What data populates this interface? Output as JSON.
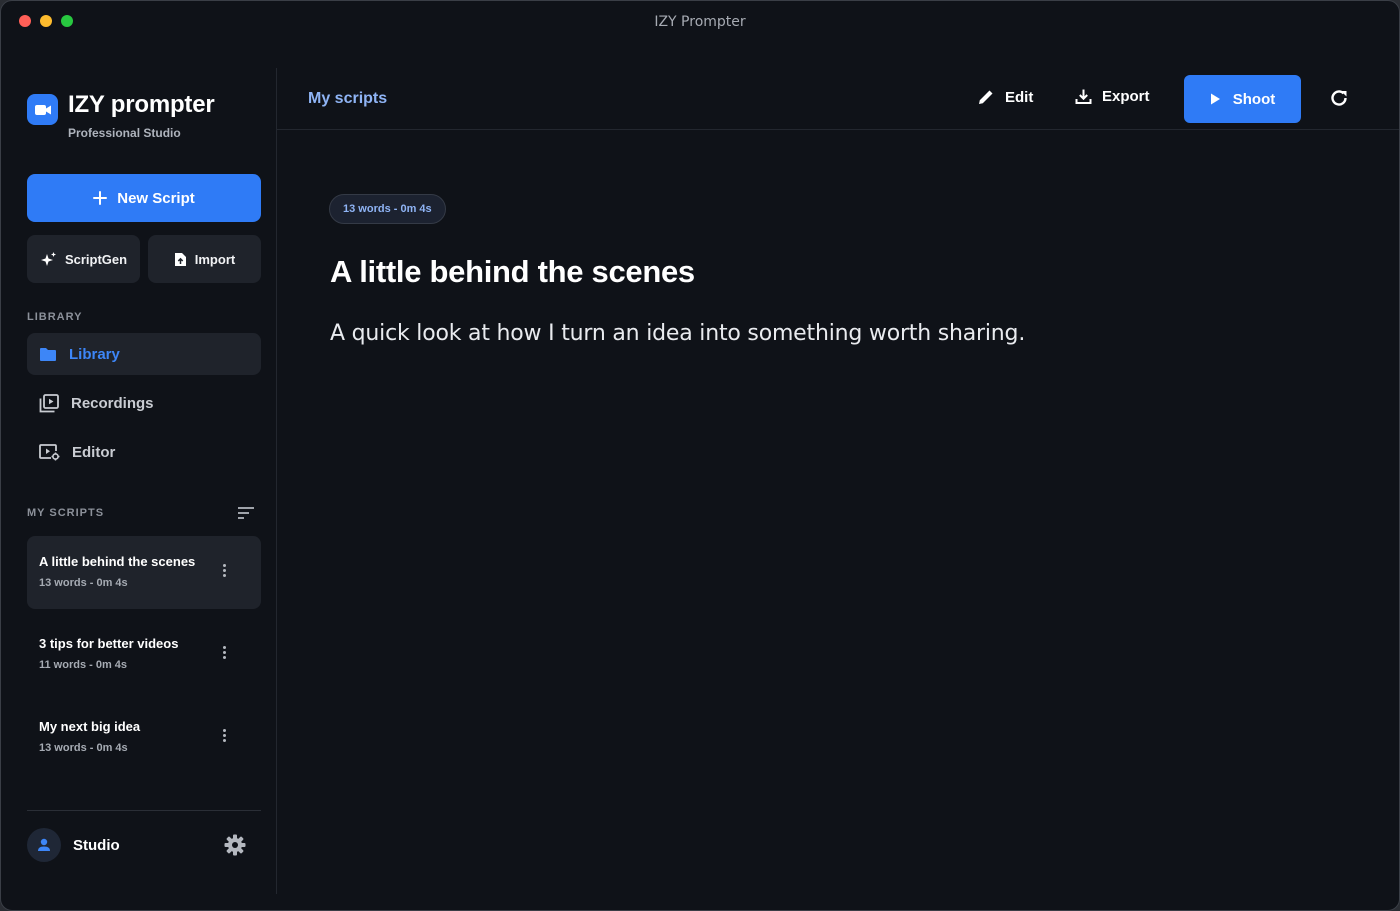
{
  "window": {
    "title": "IZY Prompter"
  },
  "colors": {
    "accent": "#2f7bf6",
    "background": "#0f1218",
    "surface": "#1f232b"
  },
  "brand": {
    "name": "IZY prompter",
    "subtitle": "Professional Studio",
    "icon": "video-camera-icon"
  },
  "actions": {
    "new_script": "New Script",
    "scriptgen": "ScriptGen",
    "import": "Import"
  },
  "library": {
    "label": "LIBRARY",
    "items": [
      {
        "label": "Library",
        "icon": "folder-icon",
        "active": true
      },
      {
        "label": "Recordings",
        "icon": "video-library-icon",
        "active": false
      },
      {
        "label": "Editor",
        "icon": "video-settings-icon",
        "active": false
      }
    ]
  },
  "scripts": {
    "label": "MY SCRIPTS",
    "items": [
      {
        "title": "A little behind the scenes",
        "meta": "13 words - 0m 4s",
        "active": true
      },
      {
        "title": "3 tips for better videos",
        "meta": "11 words - 0m 4s",
        "active": false
      },
      {
        "title": "My next big idea",
        "meta": "13 words - 0m 4s",
        "active": false
      }
    ]
  },
  "user": {
    "name": "Studio"
  },
  "topbar": {
    "crumb": "My scripts",
    "edit": "Edit",
    "export": "Export",
    "shoot": "Shoot"
  },
  "document": {
    "stats": "13 words - 0m 4s",
    "title": "A little behind the scenes",
    "body": "A quick look at how I turn an idea into something worth sharing."
  }
}
